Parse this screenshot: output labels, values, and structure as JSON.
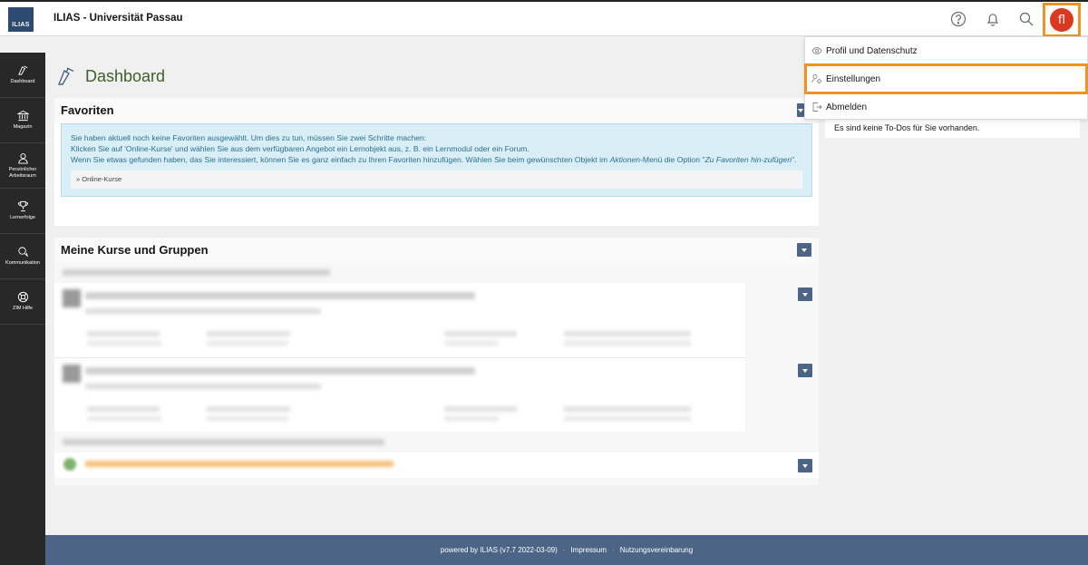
{
  "header": {
    "logo_text": "ILIAS",
    "title": "ILIAS - Universität Passau",
    "icons": [
      "help-icon",
      "bell-icon",
      "search-icon"
    ],
    "avatar_initials": "fl",
    "avatar_color": "#d9391f",
    "highlight_color": "#f3931f"
  },
  "sidebar": {
    "items": [
      {
        "label": "Dashboard",
        "icon": "dashboard-icon"
      },
      {
        "label": "Magazin",
        "icon": "repository-icon"
      },
      {
        "label": "Persönlicher Arbeitsraum",
        "icon": "person-icon"
      },
      {
        "label": "Lernerfolge",
        "icon": "trophy-icon"
      },
      {
        "label": "Kommunikation",
        "icon": "chat-icon"
      },
      {
        "label": "ZIM Hilfe",
        "icon": "lifebuoy-icon"
      }
    ]
  },
  "page": {
    "title": "Dashboard"
  },
  "favorites": {
    "title": "Favoriten",
    "info_line1": "Sie haben aktuell noch keine Favoriten ausgewählt. Um dies zu tun, müssen Sie zwei Schritte machen:",
    "info_line2": "Klicken Sie auf 'Online-Kurse' und wählen Sie aus dem verfügbaren Angebot ein Lernobjekt aus, z. B. ein Lernmodul oder ein Forum.",
    "info_line3a": "Wenn Sie etwas gefunden haben, das Sie interessiert, können Sie es ganz einfach zu Ihren Favoriten hinzufügen. Wählen Sie beim gewünschten Objekt im ",
    "info_line3_em1": "Aktionen",
    "info_line3b": "-Menü die Option \"",
    "info_line3_em2": "Zu Favoriten hin-zufügen",
    "info_line3c": "\".",
    "link": "» Online-Kurse"
  },
  "courses": {
    "title": "Meine Kurse und Gruppen"
  },
  "user_menu": {
    "items": [
      {
        "label": "Profil und Datenschutz",
        "icon": "eye-icon"
      },
      {
        "label": "Einstellungen",
        "icon": "settings-icon"
      },
      {
        "label": "Abmelden",
        "icon": "logout-icon"
      }
    ]
  },
  "todo": {
    "text": "Es sind keine To-Dos für Sie vorhanden."
  },
  "footer": {
    "powered": "powered by ILIAS (v7.7 2022-03-09)",
    "imprint": "Impressum",
    "terms": "Nutzungsvereinbarung"
  }
}
